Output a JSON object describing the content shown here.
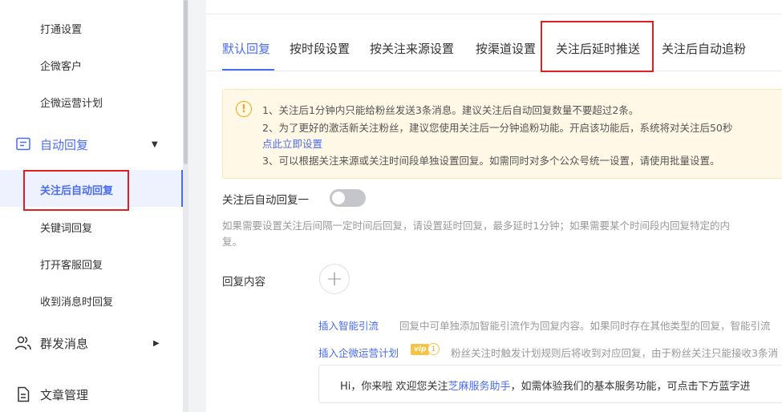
{
  "sidebar": {
    "sub_items_top": [
      "打通设置",
      "企微客户",
      "企微运营计划"
    ],
    "group_auto_reply": "自动回复",
    "auto_reply_items": [
      "关注后自动回复",
      "关键词回复",
      "打开客服回复",
      "收到消息时回复"
    ],
    "group_mass": "群发消息",
    "group_article": "文章管理"
  },
  "tabs": [
    "默认回复",
    "按时段设置",
    "按关注来源设置",
    "按渠道设置",
    "关注后延时推送",
    "关注后自动追粉"
  ],
  "notice": {
    "icon": "!",
    "line1": "1、关注后1分钟内只能给粉丝发送3条消息。建议关注后自动回复数量不要超过2条。",
    "line2": "2、为了更好的激活新关注粉丝，建议您使用关注后一分钟追粉功能。开启该功能后，系统将对关注后50秒",
    "line2_link": "点此立即设置",
    "line3": "3、可以根据关注来源或关注时间段单独设置回复。如需同时对多个公众号统一设置，请使用批量设置。"
  },
  "form": {
    "toggle_label": "关注后自动回复一",
    "hint_line1": "如果需要设置关注后间隔一定时间后回复，请设置延时回复，最多延时1分钟；如果需要某个时间段内回复特定的内",
    "hint_line2": "复。",
    "content_label": "回复内容",
    "add_symbol": "+",
    "insert_smart_link": "插入智能引流",
    "insert_smart_desc": "回复中可单独添加智能引流作为回复内容。如果同时存在其他类型的回复，智能引流",
    "insert_plan_link": "插入企微运营计划",
    "vip_label": "vip",
    "vip_level": "1",
    "insert_plan_desc": "粉丝关注时触发计划规则后将收到对应回复，由于粉丝关注只能接收3条消",
    "msg_prefix": "Hi，你来啦 欢迎您关注",
    "msg_link": "芝麻服务助手",
    "msg_suffix": "，如需体验我们的基本服务功能，可点击下方蓝字进"
  },
  "colors": {
    "accent": "#4a6cf0",
    "warning": "#f0a81c",
    "highlight_box": "#e02020"
  }
}
